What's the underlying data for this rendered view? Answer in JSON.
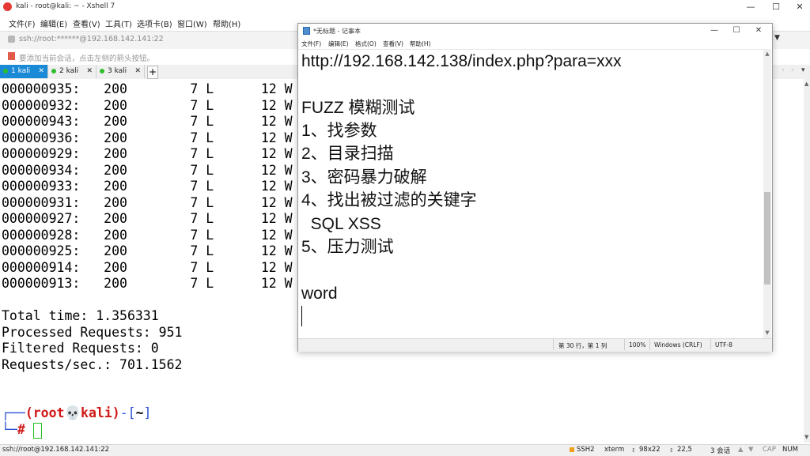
{
  "xshell": {
    "title": "kali - root@kali: ~ - Xshell 7",
    "menu": [
      "文件(F)",
      "编辑(E)",
      "查看(V)",
      "工具(T)",
      "选项卡(B)",
      "窗口(W)",
      "帮助(H)"
    ],
    "address": "ssh://root:******@192.168.142.141:22",
    "hint": "要添加当前会话，点击左侧的箭头按钮。",
    "tabs": [
      {
        "label": "1 kali",
        "active": true
      },
      {
        "label": "2 kali",
        "active": false
      },
      {
        "label": "3 kali",
        "active": false
      }
    ],
    "tab_add": "+"
  },
  "terminal": {
    "rows": [
      "000000935:   200        7 L      12 W",
      "000000932:   200        7 L      12 W",
      "000000943:   200        7 L      12 W",
      "000000936:   200        7 L      12 W",
      "000000929:   200        7 L      12 W",
      "000000934:   200        7 L      12 W",
      "000000933:   200        7 L      12 W",
      "000000931:   200        7 L      12 W",
      "000000927:   200        7 L      12 W",
      "000000928:   200        7 L      12 W",
      "000000925:   200        7 L      12 W",
      "000000914:   200        7 L      12 W",
      "000000913:   200        7 L      12 W"
    ],
    "summary": [
      "Total time: 1.356331",
      "Processed Requests: 951",
      "Filtered Requests: 0",
      "Requests/sec.: 701.1562"
    ],
    "prompt_line1_prefix": "┌──",
    "prompt_user": "(root💀kali)",
    "prompt_sep": "-[",
    "prompt_dir": "~",
    "prompt_end": "]",
    "prompt_line2_prefix": "└─",
    "prompt_hash": "#"
  },
  "statusbar": {
    "connection": "ssh://root@192.168.142.141:22",
    "protocol": "SSH2",
    "term": "xterm",
    "size": "98x22",
    "pos": "22,5",
    "sessions": "3 会话",
    "caps": "CAP",
    "num": "NUM"
  },
  "notepad": {
    "title": "*无标题 - 记事本",
    "menu": [
      "文件(F)",
      "编辑(E)",
      "格式(O)",
      "查看(V)",
      "帮助(H)"
    ],
    "lines": [
      "http://192.168.142.138/index.php?para=xxx",
      "",
      "FUZZ 模糊测试",
      "1、找参数",
      "2、目录扫描",
      "3、密码暴力破解",
      "4、找出被过滤的关键字",
      "  SQL XSS",
      "5、压力测试",
      "",
      "word"
    ],
    "status": {
      "position": "第 30 行，第 1 列",
      "zoom": "100%",
      "eol": "Windows (CRLF)",
      "encoding": "UTF-8"
    }
  }
}
